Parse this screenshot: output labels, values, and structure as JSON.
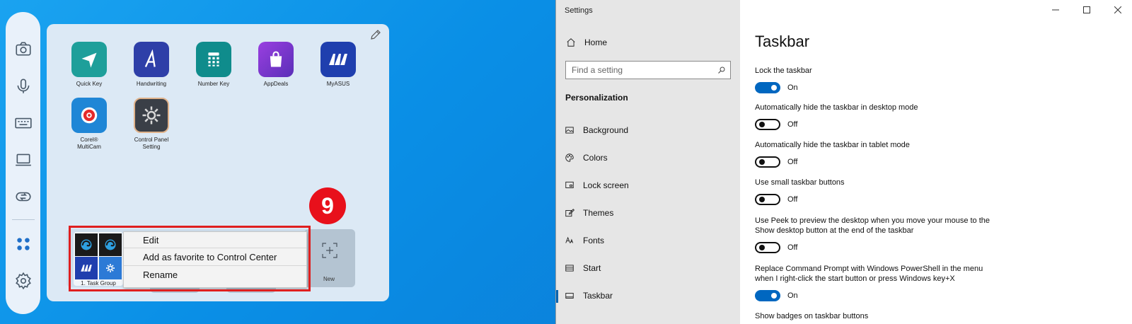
{
  "control_center": {
    "apps": [
      {
        "label": "Quick Key",
        "icon": "paper-plane-icon",
        "color": "#1e9f9a"
      },
      {
        "label": "Handwriting",
        "icon": "handwriting-a-icon",
        "color": "#2e3fa8"
      },
      {
        "label": "Number Key",
        "icon": "number-keypad-icon",
        "color": "#0f8c8c"
      },
      {
        "label": "AppDeals",
        "icon": "shopping-bag-icon",
        "color": "#7a3ac8"
      },
      {
        "label": "MyASUS",
        "icon": "myasus-logo-icon",
        "color": "#1f3fae"
      },
      {
        "label": "Corel®\nMultiCam",
        "icon": "multicam-icon",
        "color": "#1f86d6"
      },
      {
        "label": "Control Panel\nSetting",
        "icon": "gear-icon",
        "color": "#3a3f47"
      }
    ],
    "task_group_label": "1. Task Group",
    "new_label": "New",
    "context_menu": [
      "Edit",
      "Add as favorite to Control Center",
      "Rename"
    ],
    "step_badge": "9"
  },
  "settings": {
    "window_title": "Settings",
    "home_label": "Home",
    "search_placeholder": "Find a setting",
    "section_label": "Personalization",
    "nav_items": [
      "Background",
      "Colors",
      "Lock screen",
      "Themes",
      "Fonts",
      "Start",
      "Taskbar"
    ],
    "active_nav": "Taskbar",
    "page_title": "Taskbar",
    "options": [
      {
        "label": "Lock the taskbar",
        "state": "On"
      },
      {
        "label": "Automatically hide the taskbar in desktop mode",
        "state": "Off"
      },
      {
        "label": "Automatically hide the taskbar in tablet mode",
        "state": "Off"
      },
      {
        "label": "Use small taskbar buttons",
        "state": "Off"
      },
      {
        "label": "Use Peek to preview the desktop when you move your mouse to the Show desktop button at the end of the taskbar",
        "state": "Off"
      },
      {
        "label": "Replace Command Prompt with Windows PowerShell in the menu when I right-click the start button or press Windows key+X",
        "state": "On"
      },
      {
        "label": "Show badges on taskbar buttons",
        "state": ""
      }
    ]
  },
  "colors": {
    "accent": "#0067c0",
    "highlight_red": "#e01f1f"
  }
}
